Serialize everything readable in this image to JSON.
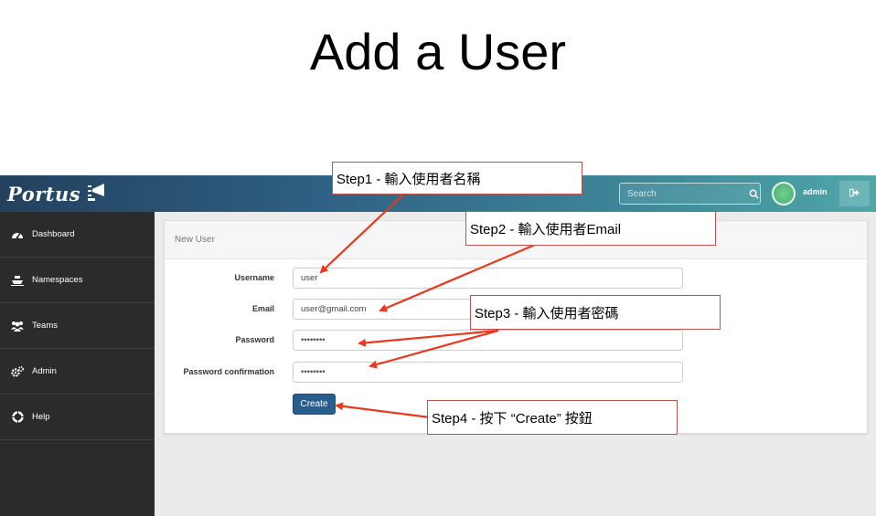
{
  "slide": {
    "title": "Add a User"
  },
  "app": {
    "logo_text": "Portus",
    "search_placeholder": "Search",
    "user_name": "admin"
  },
  "sidebar": {
    "items": [
      {
        "label": "Dashboard",
        "icon": "dashboard-icon"
      },
      {
        "label": "Namespaces",
        "icon": "namespaces-icon"
      },
      {
        "label": "Teams",
        "icon": "teams-icon"
      },
      {
        "label": "Admin",
        "icon": "admin-cogs-icon"
      },
      {
        "label": "Help",
        "icon": "help-lifebuoy-icon"
      }
    ]
  },
  "panel": {
    "title": "New User"
  },
  "form": {
    "username_label": "Username",
    "username_value": "user",
    "email_label": "Email",
    "email_value": "user@gmail.com",
    "password_label": "Password",
    "password_value": "••••••••",
    "confirm_label": "Password confirmation",
    "confirm_value": "••••••••",
    "create_label": "Create"
  },
  "annotations": [
    {
      "text": "Step1 - 輸入使用者名稱"
    },
    {
      "text": "Step2 - 輸入使用者Email"
    },
    {
      "text": "Step3 - 輸入使用者密碼"
    },
    {
      "text": "Step4 - 按下 “Create” 按鈕"
    }
  ],
  "colors": {
    "topbar_start": "#23415e",
    "topbar_end": "#4ea7a7",
    "sidebar": "#2b2b2b",
    "button": "#285e8e",
    "annotation_arrow": "#e8391c"
  }
}
